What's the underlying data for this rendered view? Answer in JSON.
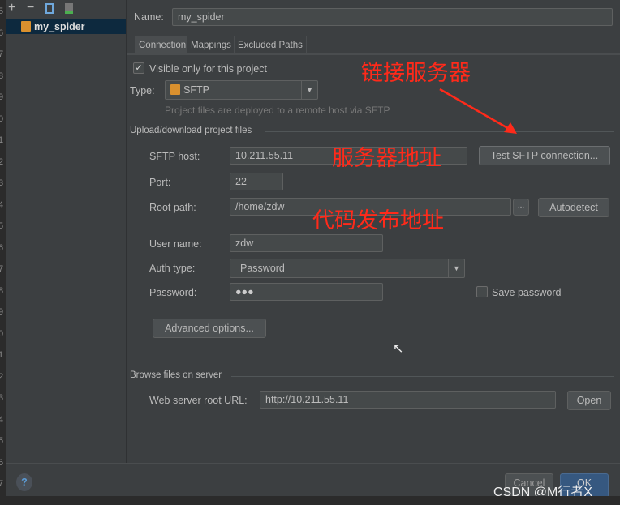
{
  "sidebar": {
    "items": [
      {
        "label": "my_spider",
        "icon": "sftp-server-icon"
      }
    ],
    "toolbar": [
      "add-icon",
      "remove-icon",
      "copy-icon",
      "default-server-icon"
    ]
  },
  "gutter": {
    "lines": [
      "5",
      "6",
      "7",
      "8",
      "9",
      "0",
      "1",
      "2",
      "3",
      "4",
      "5",
      "6",
      "7",
      "8",
      "9",
      "0",
      "1",
      "2",
      "3",
      "4",
      "5",
      "6",
      "7"
    ]
  },
  "form": {
    "name_label": "Name:",
    "name_value": "my_spider",
    "tabs": [
      {
        "label": "Connection",
        "active": true
      },
      {
        "label": "Mappings"
      },
      {
        "label": "Excluded Paths"
      }
    ],
    "visible_only_label": "Visible only for this project",
    "visible_only_checked": true,
    "type_label": "Type:",
    "type_value": "SFTP",
    "type_hint": "Project files are deployed to a remote host via SFTP",
    "upload_section": "Upload/download project files",
    "host_label": "SFTP host:",
    "host_value": "10.211.55.11",
    "test_button": "Test SFTP connection...",
    "port_label": "Port:",
    "port_value": "22",
    "root_label": "Root path:",
    "root_value": "/home/zdw",
    "browse_button": "...",
    "autodetect_button": "Autodetect",
    "user_label": "User name:",
    "user_value": "zdw",
    "auth_label": "Auth type:",
    "auth_value": "Password",
    "password_label": "Password:",
    "password_value": "●●●",
    "save_password_label": "Save password",
    "save_password_checked": false,
    "advanced_button": "Advanced options...",
    "browse_section": "Browse files on server",
    "web_label": "Web server root URL:",
    "web_value": "http://10.211.55.11",
    "open_button": "Open"
  },
  "annotations": {
    "connect": "链接服务器",
    "address": "服务器地址",
    "deploy": "代码发布地址",
    "color": "#ff2a1a"
  },
  "footer": {
    "help": "?",
    "cancel": "Cancel",
    "ok": "OK"
  },
  "watermark": "CSDN @M行者X"
}
